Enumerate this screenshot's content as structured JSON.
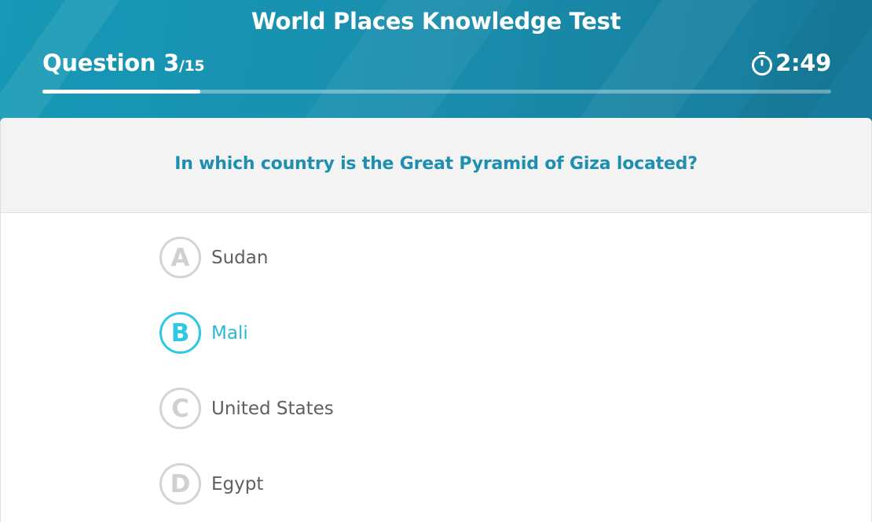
{
  "header": {
    "title": "World Places Knowledge Test",
    "question_label": "Question 3",
    "question_total": "/15",
    "timer": "2:49",
    "progress_fraction": 0.2
  },
  "question": {
    "text": "In which country is the Great Pyramid of Giza located?"
  },
  "options": [
    {
      "letter": "A",
      "label": "Sudan",
      "selected": false
    },
    {
      "letter": "B",
      "label": "Mali",
      "selected": true
    },
    {
      "letter": "C",
      "label": "United States",
      "selected": false
    },
    {
      "letter": "D",
      "label": "Egypt",
      "selected": false
    }
  ],
  "colors": {
    "header_bg": "#1a8fae",
    "question_text": "#1e8fb2",
    "selected_accent": "#2ec8e4",
    "option_text": "#5f5f5f",
    "badge_idle": "#d4d4d4"
  }
}
